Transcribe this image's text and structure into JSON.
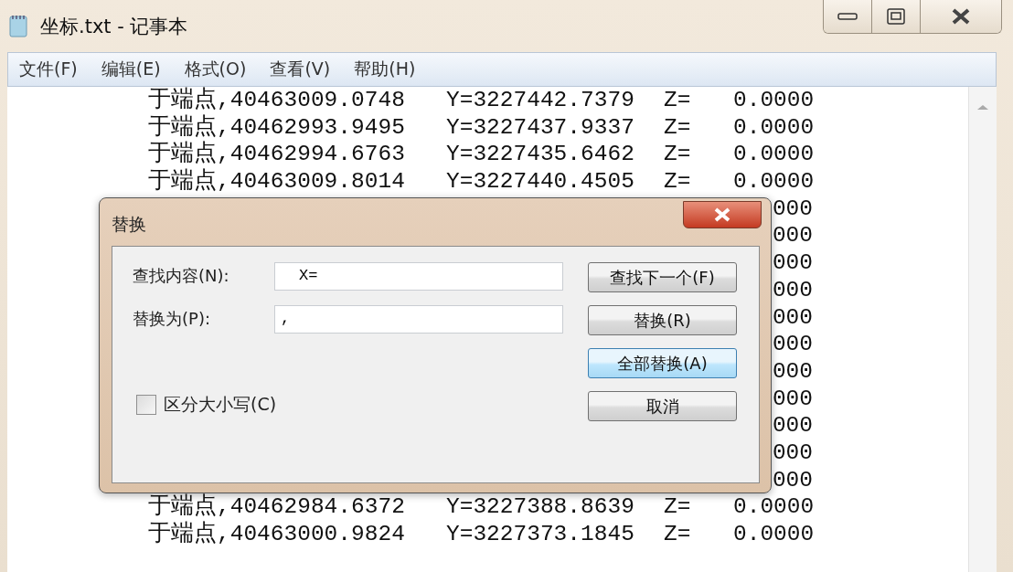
{
  "window": {
    "title": "坐标.txt - 记事本"
  },
  "menu": [
    {
      "label": "文件(F)"
    },
    {
      "label": "编辑(E)"
    },
    {
      "label": "格式(O)"
    },
    {
      "label": "查看(V)"
    },
    {
      "label": "帮助(H)"
    }
  ],
  "lines": [
    {
      "x": "于端点,40463009.0748",
      "y": "Y=3227442.7379",
      "z": "Z=",
      "value": "0.0000"
    },
    {
      "x": "于端点,40462993.9495",
      "y": "Y=3227437.9337",
      "z": "Z=",
      "value": "0.0000"
    },
    {
      "x": "于端点,40462994.6763",
      "y": "Y=3227435.6462",
      "z": "Z=",
      "value": "0.0000"
    },
    {
      "x": "于端点,40463009.8014",
      "y": "Y=3227440.4505",
      "z": "Z=",
      "value": "0.0000"
    },
    {
      "value": "000"
    },
    {
      "value": "000"
    },
    {
      "value": "000"
    },
    {
      "value": "000"
    },
    {
      "value": "000"
    },
    {
      "value": "000"
    },
    {
      "value": "000"
    },
    {
      "value": "000"
    },
    {
      "value": "000"
    },
    {
      "value": "000"
    },
    {
      "value": "000"
    },
    {
      "x": "于端点,40462984.6372",
      "y": "Y=3227388.8639",
      "z": "Z=",
      "value": "0.0000"
    },
    {
      "x": "于端点,40463000.9824",
      "y": "Y=3227373.1845",
      "z": "Z=",
      "value": "0.0000"
    }
  ],
  "dialog": {
    "title": "替换",
    "fields": [
      {
        "label": "查找内容(N):",
        "value": "X="
      },
      {
        "label": "替换为(P):",
        "value": ","
      }
    ],
    "checkbox": {
      "label": "区分大小写(C)",
      "checked": false
    },
    "buttons": [
      {
        "label": "查找下一个(F)",
        "focused": false
      },
      {
        "label": "替换(R)",
        "focused": false
      },
      {
        "label": "全部替换(A)",
        "focused": true
      },
      {
        "label": "取消",
        "focused": false
      }
    ]
  }
}
